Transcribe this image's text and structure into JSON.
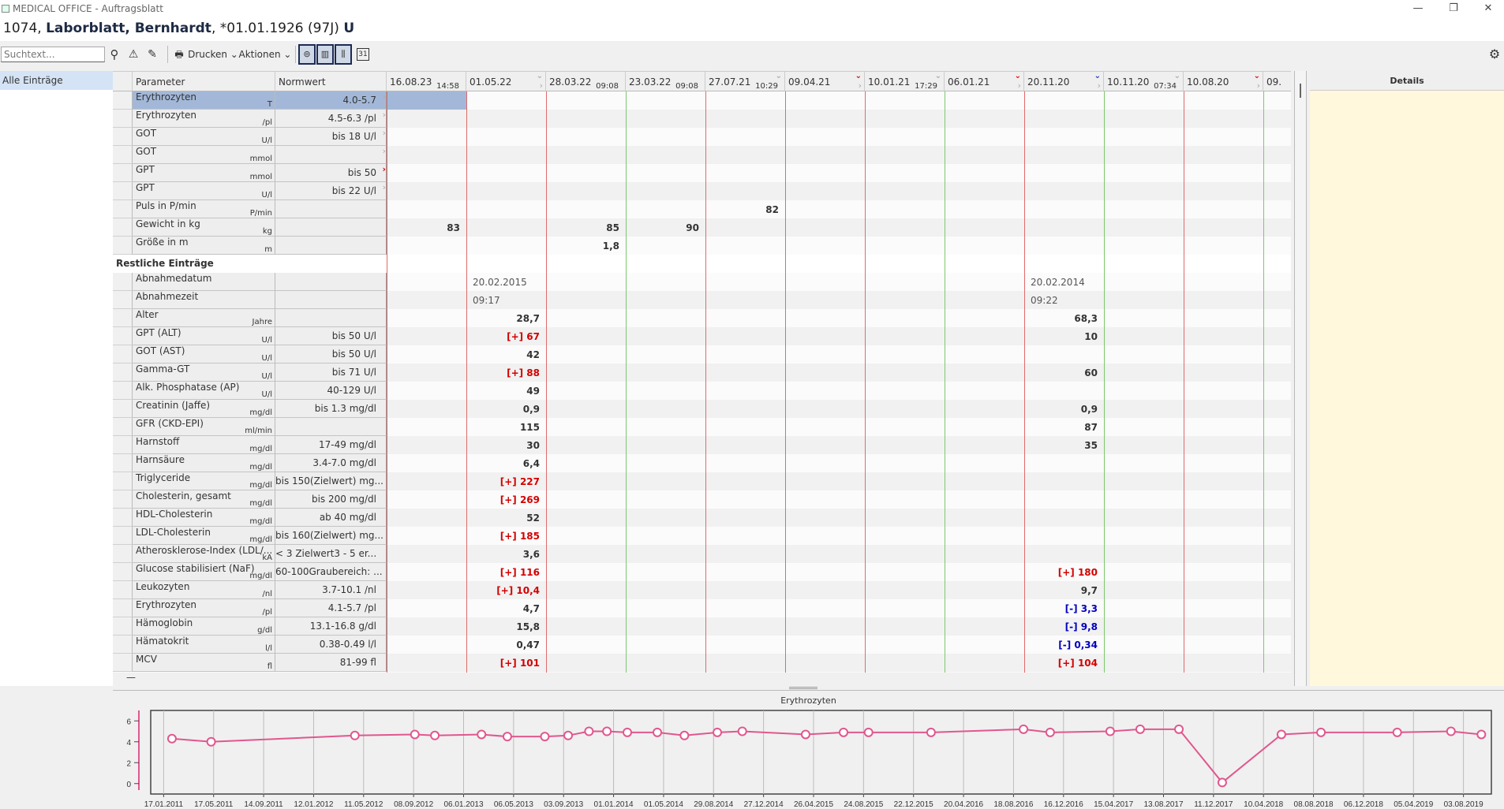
{
  "window": {
    "title": "MEDICAL OFFICE - Auftragsblatt",
    "minimize": "—",
    "restore": "❐",
    "close": "✕"
  },
  "patient": {
    "id": "1074,",
    "name": "Laborblatt, Bernhardt",
    "birth": ", *01.01.1926 (97J)",
    "flag": "U"
  },
  "toolbar": {
    "search_placeholder": "Suchtext...",
    "search_icon": "⚲",
    "warning_icon": "⚠",
    "pen_icon": "✎",
    "print_icon": "🖶",
    "print_label": "Drucken ⌄",
    "actions_label": "Aktionen ⌄",
    "toggle1": "⊚",
    "toggle2": "▥",
    "toggle3": "⫼",
    "calendar": "31",
    "gear": "⚙"
  },
  "sidebar": {
    "items": [
      {
        "label": "Alle Einträge"
      }
    ]
  },
  "table": {
    "headers": {
      "parameter": "Parameter",
      "norm": "Normwert"
    },
    "columns": [
      {
        "date": "16.08.23",
        "time": "14:58",
        "menu": null,
        "more": false,
        "line": "red"
      },
      {
        "date": "01.05.22",
        "time": "",
        "menu": "grey",
        "more": true,
        "line": "red"
      },
      {
        "date": "28.03.22",
        "time": "09:08",
        "menu": null,
        "more": false,
        "line": "red"
      },
      {
        "date": "23.03.22",
        "time": "09:08",
        "menu": null,
        "more": false,
        "line": "green"
      },
      {
        "date": "27.07.21",
        "time": "10:29",
        "menu": "grey",
        "more": false,
        "line": "red"
      },
      {
        "date": "09.04.21",
        "time": "",
        "menu": "red",
        "more": true,
        "line": "red"
      },
      {
        "date": "10.01.21",
        "time": "17:29",
        "menu": "grey",
        "more": false,
        "line": "red"
      },
      {
        "date": "06.01.21",
        "time": "",
        "menu": "red",
        "more": true,
        "line": "green"
      },
      {
        "date": "20.11.20",
        "time": "",
        "menu": "blue",
        "more": true,
        "line": "red"
      },
      {
        "date": "10.11.20",
        "time": "07:34",
        "menu": "grey",
        "more": false,
        "line": "green"
      },
      {
        "date": "10.08.20",
        "time": "",
        "menu": "red",
        "more": true,
        "line": "red"
      },
      {
        "date": "09.",
        "time": "",
        "menu": null,
        "more": false,
        "line": "green"
      }
    ],
    "group1": [
      {
        "name": "Erythrozyten",
        "unit": "T",
        "norm": "4.0-5.7",
        "arrow": "grey",
        "selected": true,
        "values": {}
      },
      {
        "name": "Erythrozyten",
        "unit": "/pl",
        "norm": "4.5-6.3 /pl",
        "arrow": "grey",
        "values": {}
      },
      {
        "name": "GOT",
        "unit": "U/l",
        "norm": "bis 18 U/l",
        "arrow": "grey",
        "values": {}
      },
      {
        "name": "GOT",
        "unit": "mmol",
        "norm": "",
        "arrow": "grey",
        "values": {}
      },
      {
        "name": "GPT",
        "unit": "mmol",
        "norm": "bis 50",
        "arrow": "red",
        "values": {}
      },
      {
        "name": "GPT",
        "unit": "U/l",
        "norm": "bis 22 U/l",
        "arrow": "grey",
        "values": {}
      },
      {
        "name": "Puls in P/min",
        "unit": "P/min",
        "norm": "",
        "values": {
          "4": "82"
        }
      },
      {
        "name": "Gewicht in kg",
        "unit": "kg",
        "norm": "",
        "values": {
          "0": "83",
          "2": "85",
          "3": "90"
        }
      },
      {
        "name": "Größe in m",
        "unit": "m",
        "norm": "",
        "values": {
          "2": "1,8"
        }
      }
    ],
    "section_label": "Restliche Einträge",
    "group2": [
      {
        "name": "Abnahmedatum",
        "unit": "",
        "norm": "",
        "plain": true,
        "values": {
          "1": "20.02.2015",
          "8": "20.02.2014"
        }
      },
      {
        "name": "Abnahmezeit",
        "unit": "",
        "norm": "",
        "plain": true,
        "values": {
          "1": "09:17",
          "8": "09:22"
        }
      },
      {
        "name": "Alter",
        "unit": "Jahre",
        "norm": "",
        "values": {
          "1": "28,7",
          "8": "68,3"
        }
      },
      {
        "name": "GPT (ALT)",
        "unit": "U/l",
        "norm": "bis 50 U/l",
        "values": {
          "1": "[+] 67",
          "8": "10"
        }
      },
      {
        "name": "GOT (AST)",
        "unit": "U/l",
        "norm": "bis 50 U/l",
        "values": {
          "1": "42"
        }
      },
      {
        "name": "Gamma-GT",
        "unit": "U/l",
        "norm": "bis 71 U/l",
        "values": {
          "1": "[+] 88",
          "8": "60"
        }
      },
      {
        "name": "Alk. Phosphatase (AP)",
        "unit": "U/l",
        "norm": "40-129 U/l",
        "values": {
          "1": "49"
        }
      },
      {
        "name": "Creatinin (Jaffe)",
        "unit": "mg/dl",
        "norm": "bis 1.3 mg/dl",
        "values": {
          "1": "0,9",
          "8": "0,9"
        }
      },
      {
        "name": "GFR (CKD-EPI)",
        "unit": "ml/min",
        "norm": "",
        "values": {
          "1": "115",
          "8": "87"
        }
      },
      {
        "name": "Harnstoff",
        "unit": "mg/dl",
        "norm": "17-49 mg/dl",
        "values": {
          "1": "30",
          "8": "35"
        }
      },
      {
        "name": "Harnsäure",
        "unit": "mg/dl",
        "norm": "3.4-7.0 mg/dl",
        "values": {
          "1": "6,4"
        }
      },
      {
        "name": "Triglyceride",
        "unit": "mg/dl",
        "norm": "bis 150(Zielwert) mg...",
        "values": {
          "1": "[+] 227"
        }
      },
      {
        "name": "Cholesterin, gesamt",
        "unit": "mg/dl",
        "norm": "bis 200 mg/dl",
        "values": {
          "1": "[+] 269"
        }
      },
      {
        "name": "HDL-Cholesterin",
        "unit": "mg/dl",
        "norm": "ab 40 mg/dl",
        "values": {
          "1": "52"
        }
      },
      {
        "name": "LDL-Cholesterin",
        "unit": "mg/dl",
        "norm": "bis 160(Zielwert) mg...",
        "values": {
          "1": "[+] 185"
        }
      },
      {
        "name": "Atherosklerose-Index (LDL/...",
        "unit": "kA",
        "norm": "< 3 Zielwert3 - 5 er...",
        "values": {
          "1": "3,6"
        }
      },
      {
        "name": "Glucose stabilisiert (NaF)",
        "unit": "mg/dl",
        "norm": "60-100Graubereich: ...",
        "values": {
          "1": "[+] 116",
          "8": "[+] 180"
        }
      },
      {
        "name": "Leukozyten",
        "unit": "/nl",
        "norm": "3.7-10.1 /nl",
        "values": {
          "1": "[+] 10,4",
          "8": "9,7"
        }
      },
      {
        "name": "Erythrozyten",
        "unit": "/pl",
        "norm": "4.1-5.7 /pl",
        "values": {
          "1": "4,7",
          "8": "[-] 3,3"
        }
      },
      {
        "name": "Hämoglobin",
        "unit": "g/dl",
        "norm": "13.1-16.8 g/dl",
        "values": {
          "1": "15,8",
          "8": "[-] 9,8"
        }
      },
      {
        "name": "Hämatokrit",
        "unit": "l/l",
        "norm": "0.38-0.49 l/l",
        "values": {
          "1": "0,47",
          "8": "[-] 0,34"
        }
      },
      {
        "name": "MCV",
        "unit": "fl",
        "norm": "81-99 fl",
        "values": {
          "1": "[+] 101",
          "8": "[+] 104"
        }
      }
    ],
    "collapse_label": "—"
  },
  "details": {
    "title": "Details"
  },
  "colors": {
    "red_line": "#e06a6a",
    "green_line": "#7cc86c",
    "series": "#e0578e",
    "high": "#d40000",
    "low": "#0000c0",
    "details_bg": "#fff8dc"
  },
  "chart_data": {
    "type": "line",
    "title": "Erythrozyten",
    "xlabel": "",
    "ylabel": "",
    "xlim": [
      "17.12.2010",
      "09.10.2019"
    ],
    "ylim": [
      -1,
      7
    ],
    "yticks": [
      0,
      2,
      4,
      6
    ],
    "grid": "vertical",
    "xticks": [
      "17.01.2011",
      "17.05.2011",
      "14.09.2011",
      "12.01.2012",
      "11.05.2012",
      "08.09.2012",
      "06.01.2013",
      "06.05.2013",
      "03.09.2013",
      "01.01.2014",
      "01.05.2014",
      "29.08.2014",
      "27.12.2014",
      "26.04.2015",
      "24.08.2015",
      "22.12.2015",
      "20.04.2016",
      "18.08.2016",
      "16.12.2016",
      "15.04.2017",
      "13.08.2017",
      "11.12.2017",
      "10.04.2018",
      "08.08.2018",
      "06.12.2018",
      "05.04.2019",
      "03.08.2019"
    ],
    "series": [
      {
        "x": [
          "06.02.2011",
          "11.05.2011",
          "20.04.2012",
          "11.09.2012",
          "29.10.2012",
          "18.02.2013",
          "21.04.2013",
          "20.07.2013",
          "14.09.2013",
          "03.11.2013",
          "16.12.2013",
          "03.02.2014",
          "16.04.2014",
          "20.06.2014",
          "07.09.2014",
          "06.11.2014",
          "07.04.2015",
          "07.07.2015",
          "05.09.2015",
          "02.02.2016",
          "11.09.2016",
          "14.11.2016",
          "07.04.2017",
          "18.06.2017",
          "19.09.2017",
          "01.01.2018",
          "23.05.2018",
          "26.08.2018",
          "25.02.2019",
          "04.07.2019",
          "15.09.2019"
        ],
        "y": [
          4.3,
          4.0,
          4.6,
          4.7,
          4.6,
          4.7,
          4.5,
          4.5,
          4.6,
          5.0,
          5.0,
          4.9,
          4.9,
          4.6,
          4.9,
          5.0,
          4.7,
          4.9,
          4.9,
          4.9,
          5.2,
          4.9,
          5.0,
          5.2,
          5.2,
          0.1,
          4.7,
          4.9,
          4.9,
          5.0,
          4.7
        ]
      }
    ]
  }
}
